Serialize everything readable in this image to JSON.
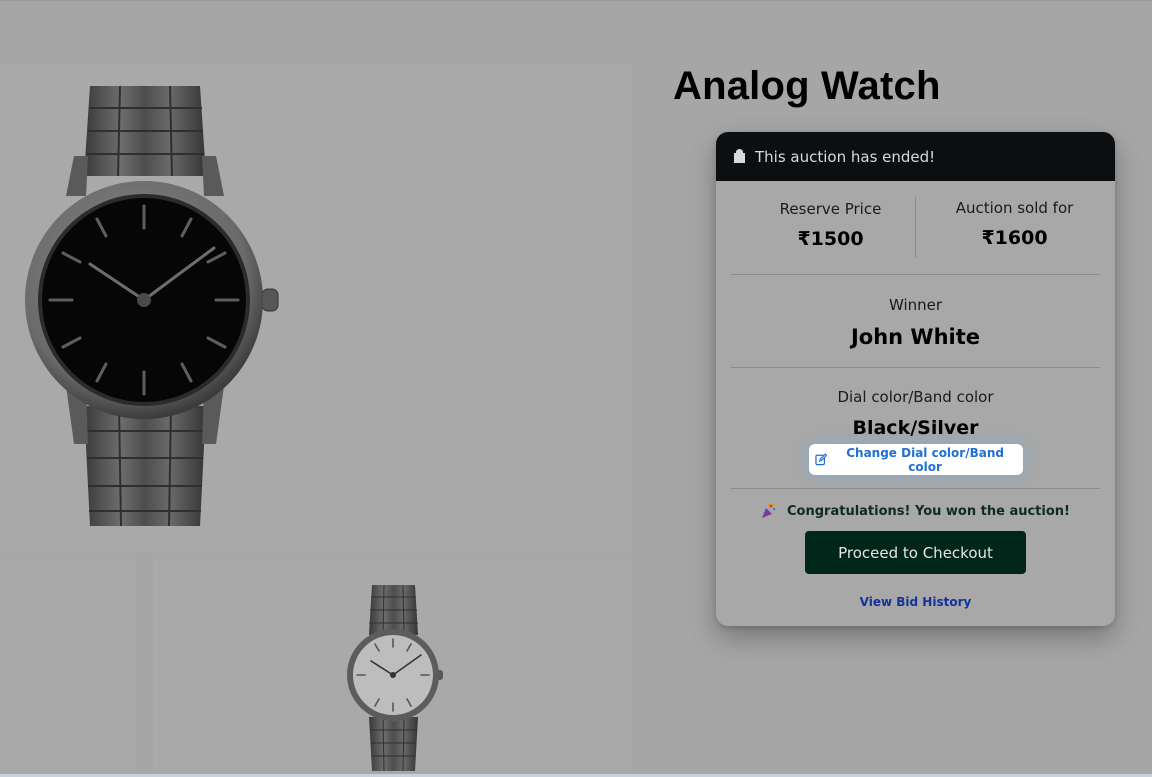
{
  "product": {
    "title": "Analog Watch"
  },
  "auction": {
    "status": "This auction has ended!",
    "reserve_label": "Reserve Price",
    "reserve_value": "₹1500",
    "sold_label": "Auction sold for",
    "sold_value": "₹1600",
    "winner_label": "Winner",
    "winner_name": "John White",
    "color_label": "Dial color/Band color",
    "color_value": "Black/Silver",
    "change_color_label": "Change Dial color/Band color",
    "congrats_text": "Congratulations! You won the auction!",
    "checkout_label": "Proceed to Checkout",
    "history_label": "View Bid History"
  },
  "icons": {
    "header": "shopping-bag-icon",
    "change": "edit-icon",
    "congrats": "party-popper-icon"
  },
  "colors": {
    "header_bg": "#0c0f12",
    "checkout_bg": "#00261a",
    "link": "#13329a",
    "change_text": "#1f6fd6"
  }
}
